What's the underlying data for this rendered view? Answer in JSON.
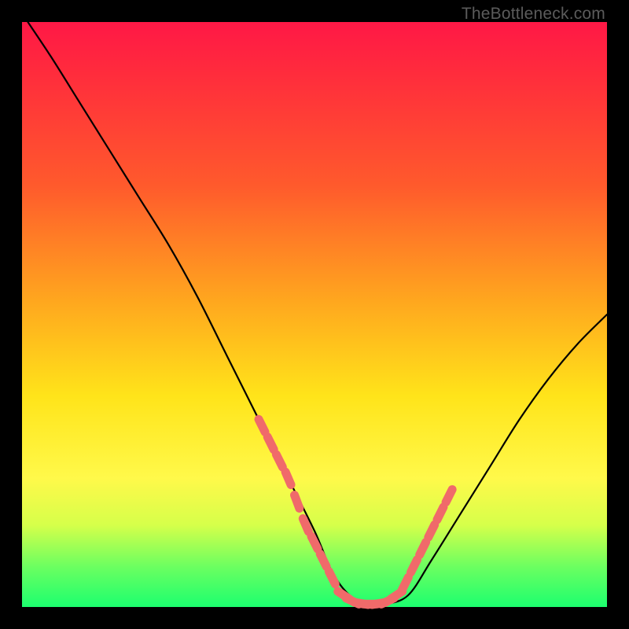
{
  "watermark": "TheBottleneck.com",
  "chart_data": {
    "type": "line",
    "title": "",
    "xlabel": "",
    "ylabel": "",
    "xlim": [
      0,
      100
    ],
    "ylim": [
      0,
      100
    ],
    "grid": false,
    "legend": false,
    "series": [
      {
        "name": "bottleneck-curve",
        "color": "#000000",
        "x": [
          1,
          5,
          10,
          15,
          20,
          25,
          30,
          35,
          40,
          45,
          50,
          53,
          56,
          59,
          62,
          66,
          70,
          75,
          80,
          85,
          90,
          95,
          100
        ],
        "y": [
          100,
          94,
          86,
          78,
          70,
          62,
          53,
          43,
          33,
          23,
          13,
          6,
          2,
          0.5,
          0.5,
          2,
          8,
          16,
          24,
          32,
          39,
          45,
          50
        ]
      },
      {
        "name": "highlight-dots-left",
        "color": "#f06a6a",
        "type": "scatter",
        "x": [
          41,
          42.5,
          44,
          45.5,
          47,
          48.5,
          50,
          51.5,
          53
        ],
        "y": [
          31,
          28,
          25,
          22,
          18,
          14,
          11,
          8,
          5
        ]
      },
      {
        "name": "highlight-dots-bottom",
        "color": "#f06a6a",
        "type": "scatter",
        "x": [
          55,
          56.5,
          58,
          59.5,
          61,
          62.5,
          64
        ],
        "y": [
          2,
          1,
          0.6,
          0.5,
          0.6,
          1,
          2
        ]
      },
      {
        "name": "highlight-dots-right",
        "color": "#f06a6a",
        "type": "scatter",
        "x": [
          65.5,
          67,
          68.5,
          70,
          71.5,
          73
        ],
        "y": [
          4,
          7,
          10,
          13,
          16,
          19
        ]
      }
    ]
  }
}
